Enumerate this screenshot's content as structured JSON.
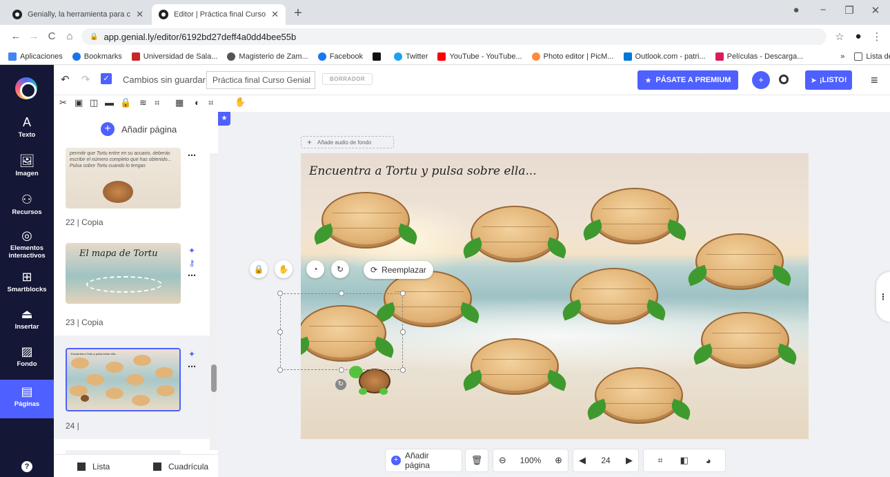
{
  "browser": {
    "tabs": [
      {
        "title": "Genially, la herramienta para cre",
        "active": false
      },
      {
        "title": "Editor | Práctica final Curso Genia",
        "active": true
      }
    ],
    "url": "app.genial.ly/editor/6192bd27deff4a0dd4bee55b",
    "bookmarks": [
      "Aplicaciones",
      "Bookmarks",
      "Universidad de Sala...",
      "Magisterio de Zam...",
      "Facebook",
      "",
      "Twitter",
      "YouTube - YouTube...",
      "Photo editor | PicM...",
      "Outlook.com - patri...",
      "Películas - Descarga..."
    ],
    "reading_list": "Lista de lectura",
    "more_bookmarks": "»"
  },
  "sidebar": {
    "items": [
      {
        "label": "Texto",
        "icon": "text-icon",
        "glyph": "A"
      },
      {
        "label": "Imagen",
        "icon": "image-icon",
        "glyph": "🖼"
      },
      {
        "label": "Recursos",
        "icon": "resources-icon",
        "glyph": "⚇"
      },
      {
        "label": "Elementos interactivos",
        "icon": "interactive-icon",
        "glyph": "◎"
      },
      {
        "label": "Smartblocks",
        "icon": "smartblocks-icon",
        "glyph": "⊞"
      },
      {
        "label": "Insertar",
        "icon": "insert-icon",
        "glyph": "⏏"
      },
      {
        "label": "Fondo",
        "icon": "background-icon",
        "glyph": "▨"
      },
      {
        "label": "Páginas",
        "icon": "pages-icon",
        "glyph": "▤",
        "active": true
      }
    ],
    "help": "?"
  },
  "topbar": {
    "save_state": "Cambios sin guardar",
    "title": "Práctica final Curso Genial",
    "draft": "BORRADOR",
    "premium": "PÁSATE A PREMIUM",
    "done": "¡LISTO!"
  },
  "pages": {
    "add_label": "Añadir página",
    "items": [
      {
        "label": "22 | Copia",
        "text": "permitir que Tortu entre en su acuario, deberás escribir el número completo que has obtenido... Pulsa sobre Tortu cuando lo tengas"
      },
      {
        "label": "23 | Copia",
        "text": "El mapa de Tortu"
      },
      {
        "label": "24 |",
        "text": "Encuentra a Tortu y pulsa sobre ella...",
        "selected": true
      }
    ],
    "view_list": "Lista",
    "view_grid": "Cuadrícula"
  },
  "canvas": {
    "audio_label": "Añade audio de fondo",
    "slide_title": "Encuentra a Tortu y pulsa sobre ella...",
    "replace_label": "Reemplazar"
  },
  "bottombar": {
    "add_page": "Añadir página",
    "zoom": "100%",
    "page_number": "24"
  }
}
